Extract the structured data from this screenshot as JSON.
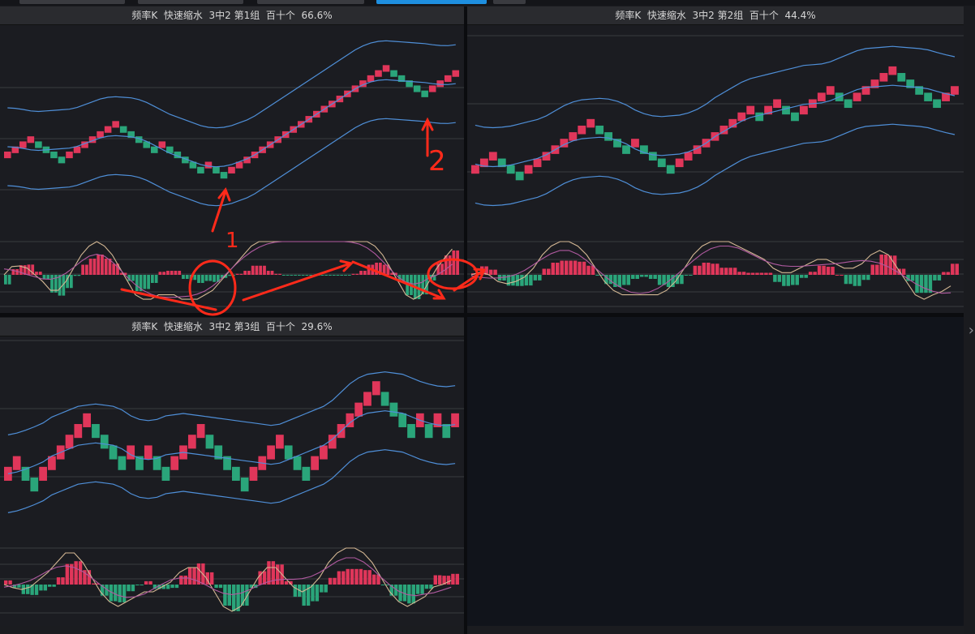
{
  "tabs": [
    {
      "label": ""
    },
    {
      "label": ""
    },
    {
      "label": ""
    },
    {
      "label": ""
    },
    {
      "label": ""
    }
  ],
  "panels": [
    {
      "title": "频率K  快速缩水  3中2 第1组  百十个  66.6%"
    },
    {
      "title": "频率K  快速缩水  3中2 第2组  百十个  44.4%"
    },
    {
      "title": "频率K  快速缩水  3中2 第3组  百十个  29.6%"
    }
  ],
  "annotations": {
    "label1": "1",
    "label2": "2"
  },
  "colors": {
    "up": "#e0365a",
    "down": "#2aa57a",
    "band": "#4f8fd8",
    "dif": "#d4b894",
    "dea": "#b05aa0",
    "annotation": "#ff2a1a"
  },
  "icons": {
    "expand": "chevron-right-icon"
  },
  "chart_data": [
    {
      "type": "candlestick",
      "name": "panel-1",
      "blocks": [
        0,
        1,
        2,
        3,
        2,
        1,
        0,
        -1,
        0,
        1,
        2,
        3,
        4,
        5,
        6,
        5,
        4,
        3,
        2,
        1,
        2,
        1,
        0,
        -1,
        -2,
        -3,
        -2,
        -3,
        -4,
        -3,
        -2,
        -1,
        0,
        1,
        2,
        3,
        4,
        5,
        6,
        7,
        8,
        9,
        10,
        11,
        12,
        13,
        14,
        15,
        16,
        17,
        16,
        15,
        14,
        13,
        12,
        13,
        14,
        15,
        16
      ]
    },
    {
      "type": "candlestick",
      "name": "panel-2",
      "blocks": [
        0,
        1,
        2,
        1,
        0,
        -1,
        0,
        1,
        2,
        3,
        4,
        5,
        6,
        7,
        6,
        5,
        4,
        3,
        4,
        3,
        2,
        1,
        0,
        1,
        2,
        3,
        4,
        5,
        6,
        7,
        8,
        9,
        8,
        9,
        10,
        9,
        8,
        9,
        10,
        11,
        12,
        11,
        10,
        11,
        12,
        13,
        14,
        15,
        14,
        13,
        12,
        11,
        10,
        11,
        12
      ]
    },
    {
      "type": "candlestick",
      "name": "panel-3",
      "blocks": [
        0,
        1,
        0,
        -1,
        0,
        1,
        2,
        3,
        4,
        5,
        4,
        3,
        2,
        1,
        2,
        1,
        2,
        1,
        0,
        1,
        2,
        3,
        4,
        3,
        2,
        1,
        0,
        -1,
        0,
        1,
        2,
        3,
        2,
        1,
        0,
        1,
        2,
        3,
        4,
        5,
        6,
        7,
        8,
        7,
        6,
        5,
        4,
        5,
        4,
        5,
        4,
        5
      ]
    }
  ]
}
